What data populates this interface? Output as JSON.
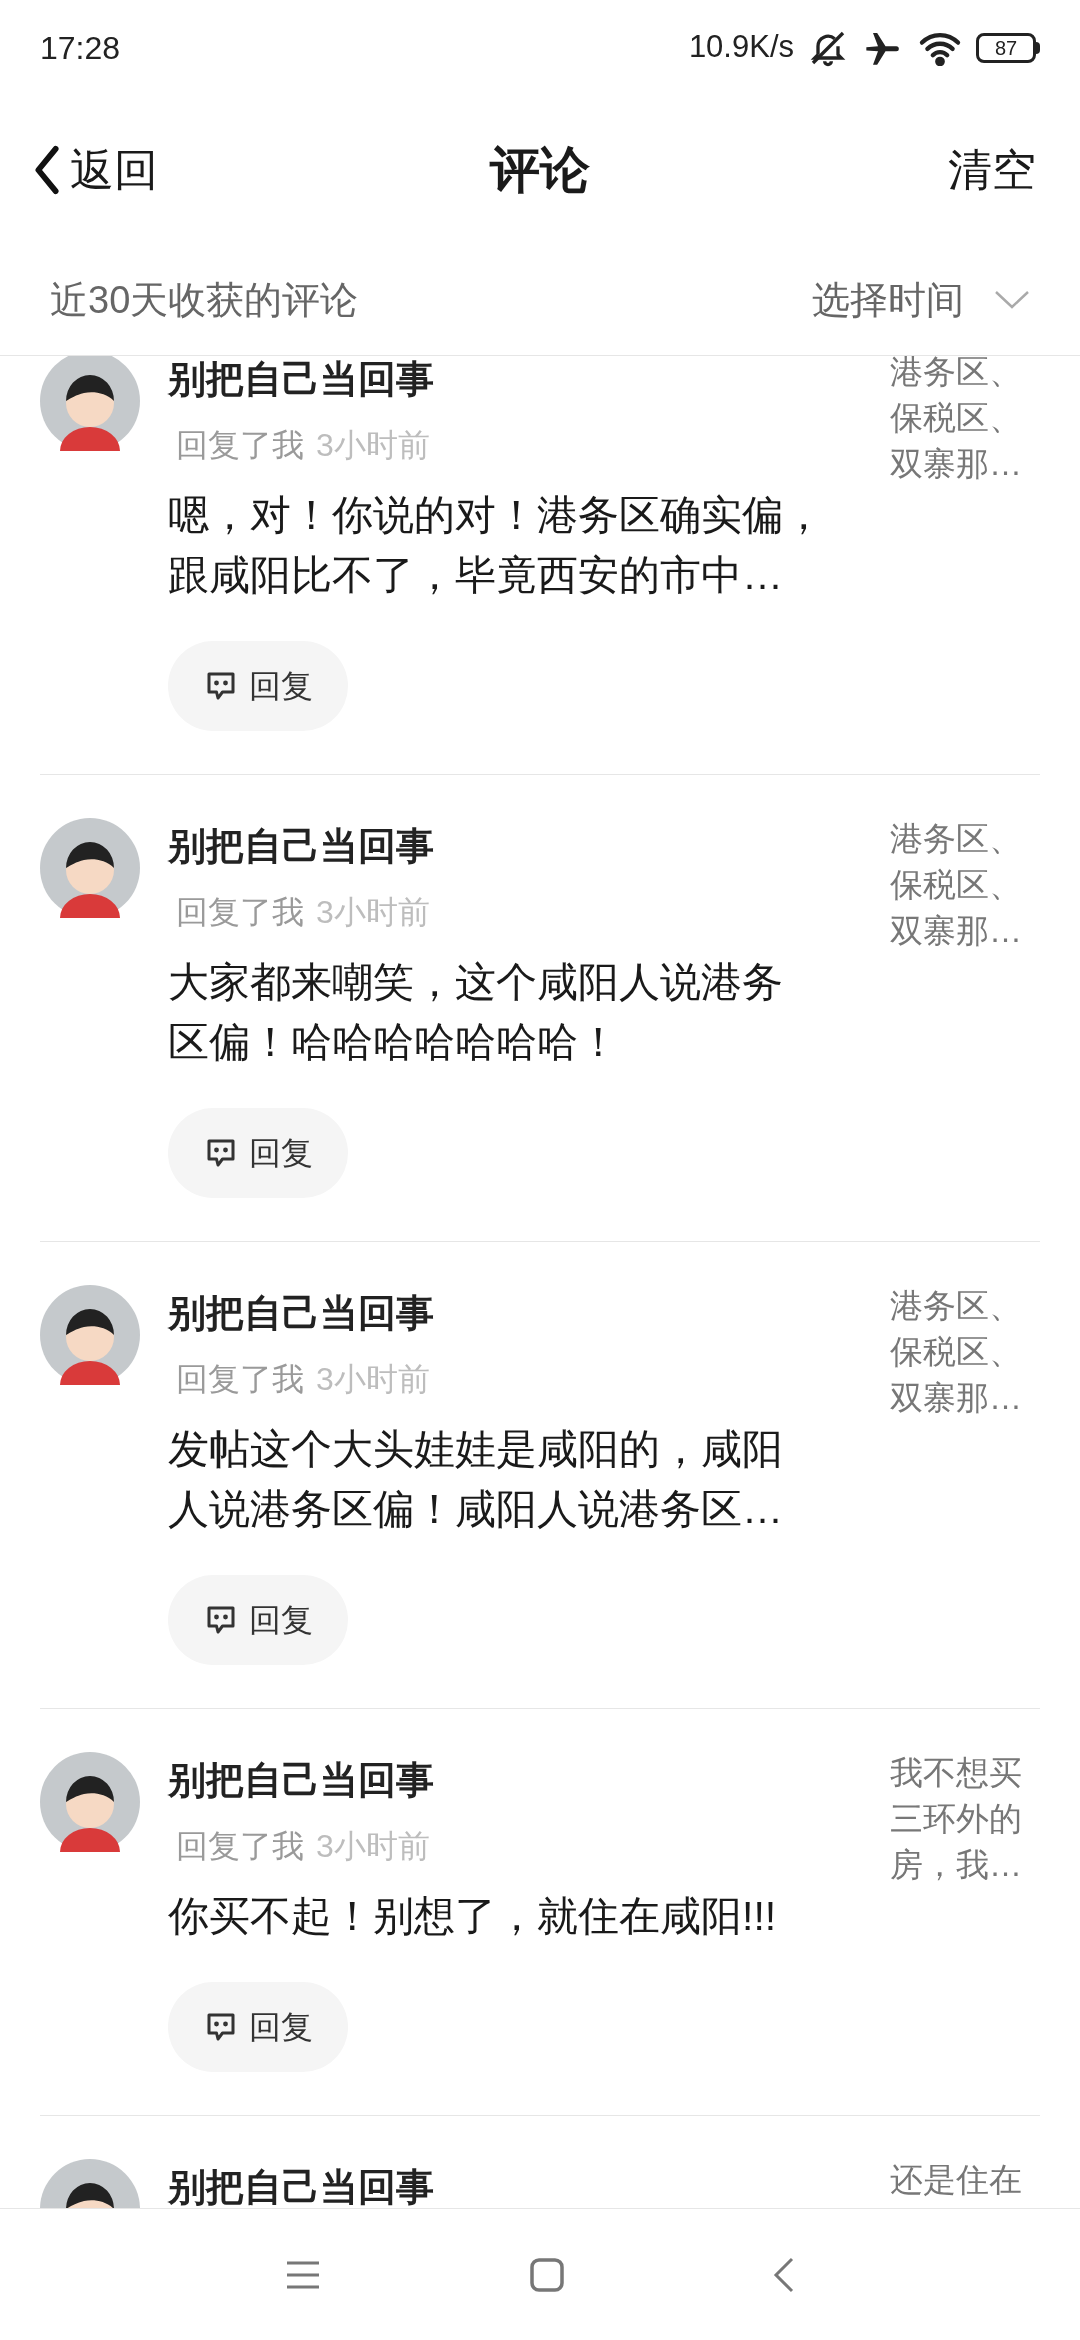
{
  "status_bar": {
    "time": "17:28",
    "net_speed": "10.9K/s",
    "battery": "87"
  },
  "header": {
    "back": "返回",
    "title": "评论",
    "action": "清空"
  },
  "filter": {
    "label": "近30天收获的评论",
    "picker": "选择时间"
  },
  "comments": [
    {
      "user": "别把自己当回事",
      "action": "回复了我",
      "time": "3小时前",
      "text_lines": [
        "嗯，对！你说的对！港务区确实偏，",
        "跟咸阳比不了，毕竟西安的市中…"
      ],
      "reply": "回复",
      "quote_lines": [
        "港务区、",
        "保税区、",
        "双寨那…"
      ]
    },
    {
      "user": "别把自己当回事",
      "action": "回复了我",
      "time": "3小时前",
      "text_lines": [
        "大家都来嘲笑，这个咸阳人说港务",
        "区偏！哈哈哈哈哈哈哈！"
      ],
      "reply": "回复",
      "quote_lines": [
        "港务区、",
        "保税区、",
        "双寨那…"
      ]
    },
    {
      "user": "别把自己当回事",
      "action": "回复了我",
      "time": "3小时前",
      "text_lines": [
        "发帖这个大头娃娃是咸阳的，咸阳",
        "人说港务区偏！咸阳人说港务区…"
      ],
      "reply": "回复",
      "quote_lines": [
        "港务区、",
        "保税区、",
        "双寨那…"
      ]
    },
    {
      "user": "别把自己当回事",
      "action": "回复了我",
      "time": "3小时前",
      "text_lines": [
        "你买不起！别想了，就住在咸阳!!!"
      ],
      "reply": "回复",
      "quote_lines": [
        "我不想买",
        "三环外的",
        "房，我…"
      ]
    },
    {
      "user": "别把自己当回事",
      "quote_lines": [
        "还是住在"
      ]
    }
  ]
}
